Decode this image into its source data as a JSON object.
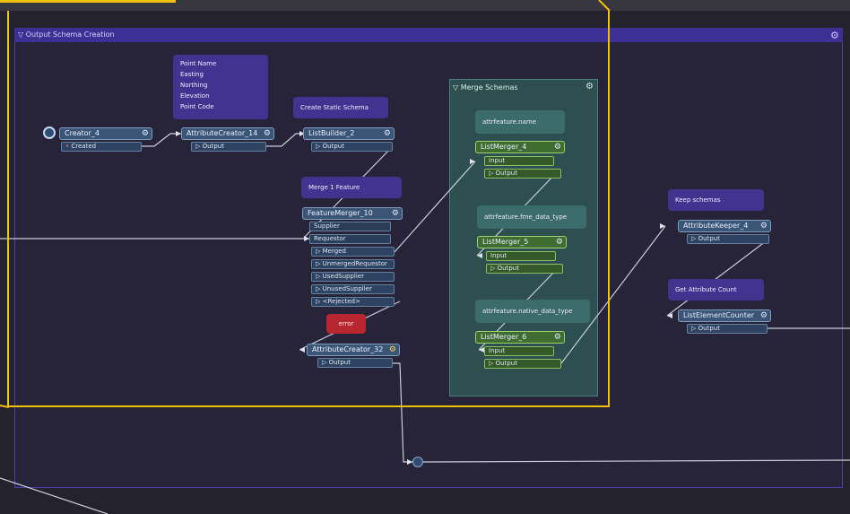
{
  "bookmark": {
    "title": "Output Schema Creation",
    "gear_icon": "gear-icon"
  },
  "merge_bookmark": {
    "title": "Merge Schemas"
  },
  "notes": {
    "attr_list": [
      "Point Name",
      "Easting",
      "Northing",
      "Elevation",
      "Point Code"
    ],
    "create_static_schema": "Create Static Schema",
    "merge_1_feature": "Merge 1 Feature",
    "error": "error",
    "attrfeature_name": "attrfeature.name",
    "attrfeature_fme_data_type": "attrfeature.fme_data_type",
    "attrfeature_native_data_type": "attrfeature.native_data_type",
    "keep_schema": "Keep schemas",
    "get_attribute_count": "Get Attribute Count"
  },
  "transformers": {
    "creator": {
      "name": "Creator_4",
      "port": "Created"
    },
    "attribute_creator_14": {
      "name": "AttributeCreator_14",
      "port": "Output"
    },
    "list_builder": {
      "name": "ListBuilder_2",
      "port": "Output"
    },
    "feature_merger": {
      "name": "FeatureMerger_10",
      "inputs": [
        "Supplier",
        "Requestor"
      ],
      "outputs": [
        "Merged",
        "UnmergedRequestor",
        "UsedSupplier",
        "UnusedSupplier",
        "<Rejected>"
      ]
    },
    "attribute_creator_32": {
      "name": "AttributeCreator_32",
      "port": "Output"
    },
    "list_merger_4": {
      "name": "ListMerger_4",
      "input": "Input",
      "output": "Output"
    },
    "list_merger_5": {
      "name": "ListMerger_5",
      "input": "Input",
      "output": "Output"
    },
    "list_merger_6": {
      "name": "ListMerger_6",
      "input": "Input",
      "output": "Output"
    },
    "attribute_keeper": {
      "name": "AttributeKeeper_4",
      "port": "Output"
    },
    "list_element_counter": {
      "name": "ListElementCounter",
      "port": "Output"
    }
  },
  "colors": {
    "selection": "#f2c200",
    "bookmark_header": "#3d2f94",
    "transformer": "#3b5576",
    "list_merger": "#3f6d31"
  }
}
